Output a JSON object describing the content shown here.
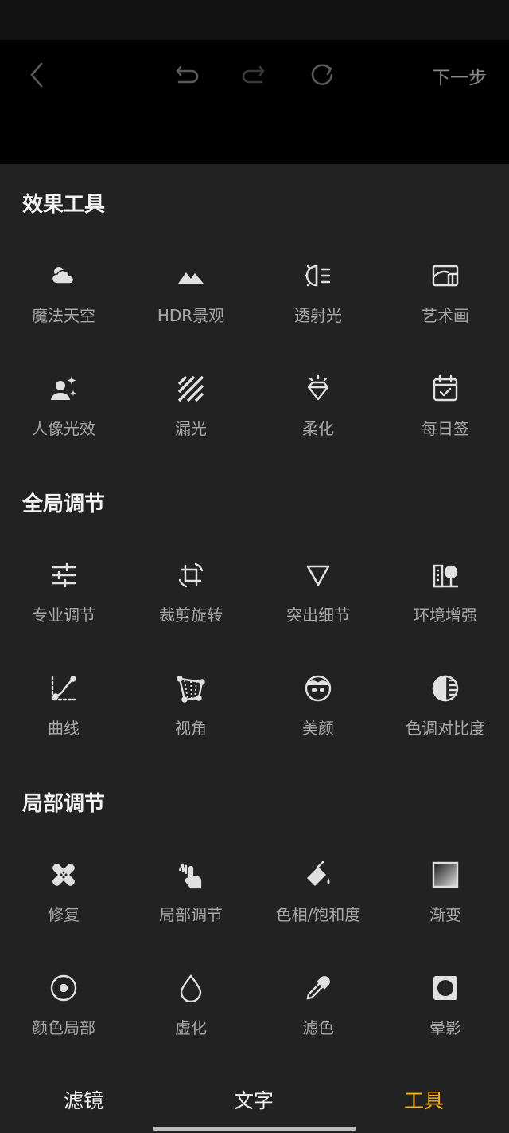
{
  "header": {
    "next_label": "下一步",
    "icons": [
      "back-icon",
      "undo-icon",
      "redo-icon",
      "refresh-icon"
    ]
  },
  "sections": [
    {
      "title": "效果工具",
      "tools": [
        {
          "label": "魔法天空",
          "icon": "cloud-icon"
        },
        {
          "label": "HDR景观",
          "icon": "mountain-icon"
        },
        {
          "label": "透射光",
          "icon": "light-beam-icon"
        },
        {
          "label": "艺术画",
          "icon": "art-frame-icon"
        },
        {
          "label": "人像光效",
          "icon": "portrait-sparkle-icon"
        },
        {
          "label": "漏光",
          "icon": "stripes-icon"
        },
        {
          "label": "柔化",
          "icon": "diamond-icon"
        },
        {
          "label": "每日签",
          "icon": "calendar-check-icon"
        }
      ]
    },
    {
      "title": "全局调节",
      "tools": [
        {
          "label": "专业调节",
          "icon": "sliders-icon"
        },
        {
          "label": "裁剪旋转",
          "icon": "crop-rotate-icon"
        },
        {
          "label": "突出细节",
          "icon": "triangle-icon"
        },
        {
          "label": "环境增强",
          "icon": "building-tree-icon"
        },
        {
          "label": "曲线",
          "icon": "curve-icon"
        },
        {
          "label": "视角",
          "icon": "perspective-icon"
        },
        {
          "label": "美颜",
          "icon": "face-icon"
        },
        {
          "label": "色调对比度",
          "icon": "contrast-icon"
        }
      ]
    },
    {
      "title": "局部调节",
      "tools": [
        {
          "label": "修复",
          "icon": "bandage-icon"
        },
        {
          "label": "局部调节",
          "icon": "touch-brush-icon"
        },
        {
          "label": "色相/饱和度",
          "icon": "paint-bucket-icon"
        },
        {
          "label": "渐变",
          "icon": "gradient-icon"
        },
        {
          "label": "颜色局部",
          "icon": "target-icon"
        },
        {
          "label": "虚化",
          "icon": "drop-icon"
        },
        {
          "label": "滤色",
          "icon": "eyedropper-icon"
        },
        {
          "label": "晕影",
          "icon": "vignette-icon"
        }
      ]
    }
  ],
  "bottom_nav": [
    {
      "label": "滤镜",
      "active": false
    },
    {
      "label": "文字",
      "active": false
    },
    {
      "label": "工具",
      "active": true
    }
  ],
  "colors": {
    "accent": "#f5b324",
    "background": "#222222",
    "header": "#000000"
  }
}
